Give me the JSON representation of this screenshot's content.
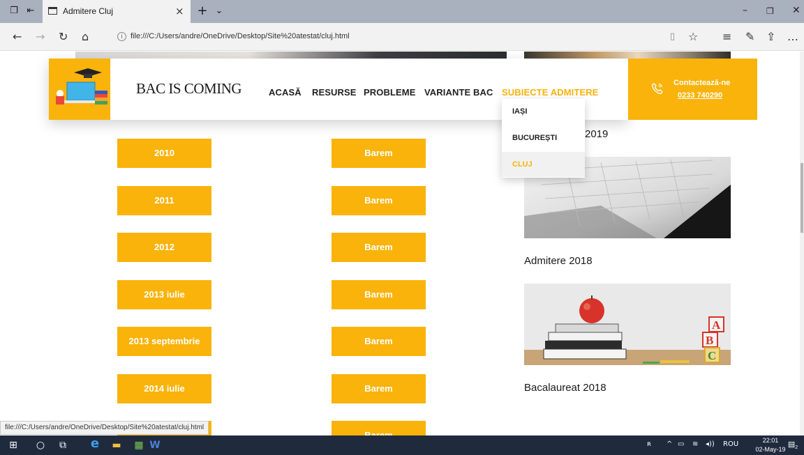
{
  "browser": {
    "tab_title": "Admitere Cluj",
    "url": "file:///C:/Users/andre/OneDrive/Desktop/Site%20atestat/cluj.html",
    "status_url": "file:///C:/Users/andre/OneDrive/Desktop/Site%20atestat/cluj.html"
  },
  "site": {
    "brand": "BAC IS COMING",
    "nav": [
      "ACASĂ",
      "RESURSE",
      "PROBLEME",
      "VARIANTE BAC",
      "SUBIECTE ADMITERE"
    ],
    "nav_active": "SUBIECTE ADMITERE",
    "dropdown": [
      "IAȘI",
      "BUCUREȘTI",
      "CLUJ"
    ],
    "dropdown_active": "CLUJ",
    "contact_label": "Contactează-ne",
    "contact_phone": "0233 740290"
  },
  "content": {
    "years": [
      "2010",
      "2011",
      "2012",
      "2013 iulie",
      "2013 septembrie",
      "2014 iulie",
      ""
    ],
    "barem_label": "Barem",
    "partial_heading": "2019",
    "news": [
      "Admitere 2018",
      "Bacalaureat 2018"
    ]
  },
  "taskbar": {
    "lang": "ROU",
    "time": "22:01",
    "date": "02-May-19",
    "notif_count": "2"
  },
  "colors": {
    "accent": "#f9b30b",
    "taskbar": "#1f2a3d"
  }
}
